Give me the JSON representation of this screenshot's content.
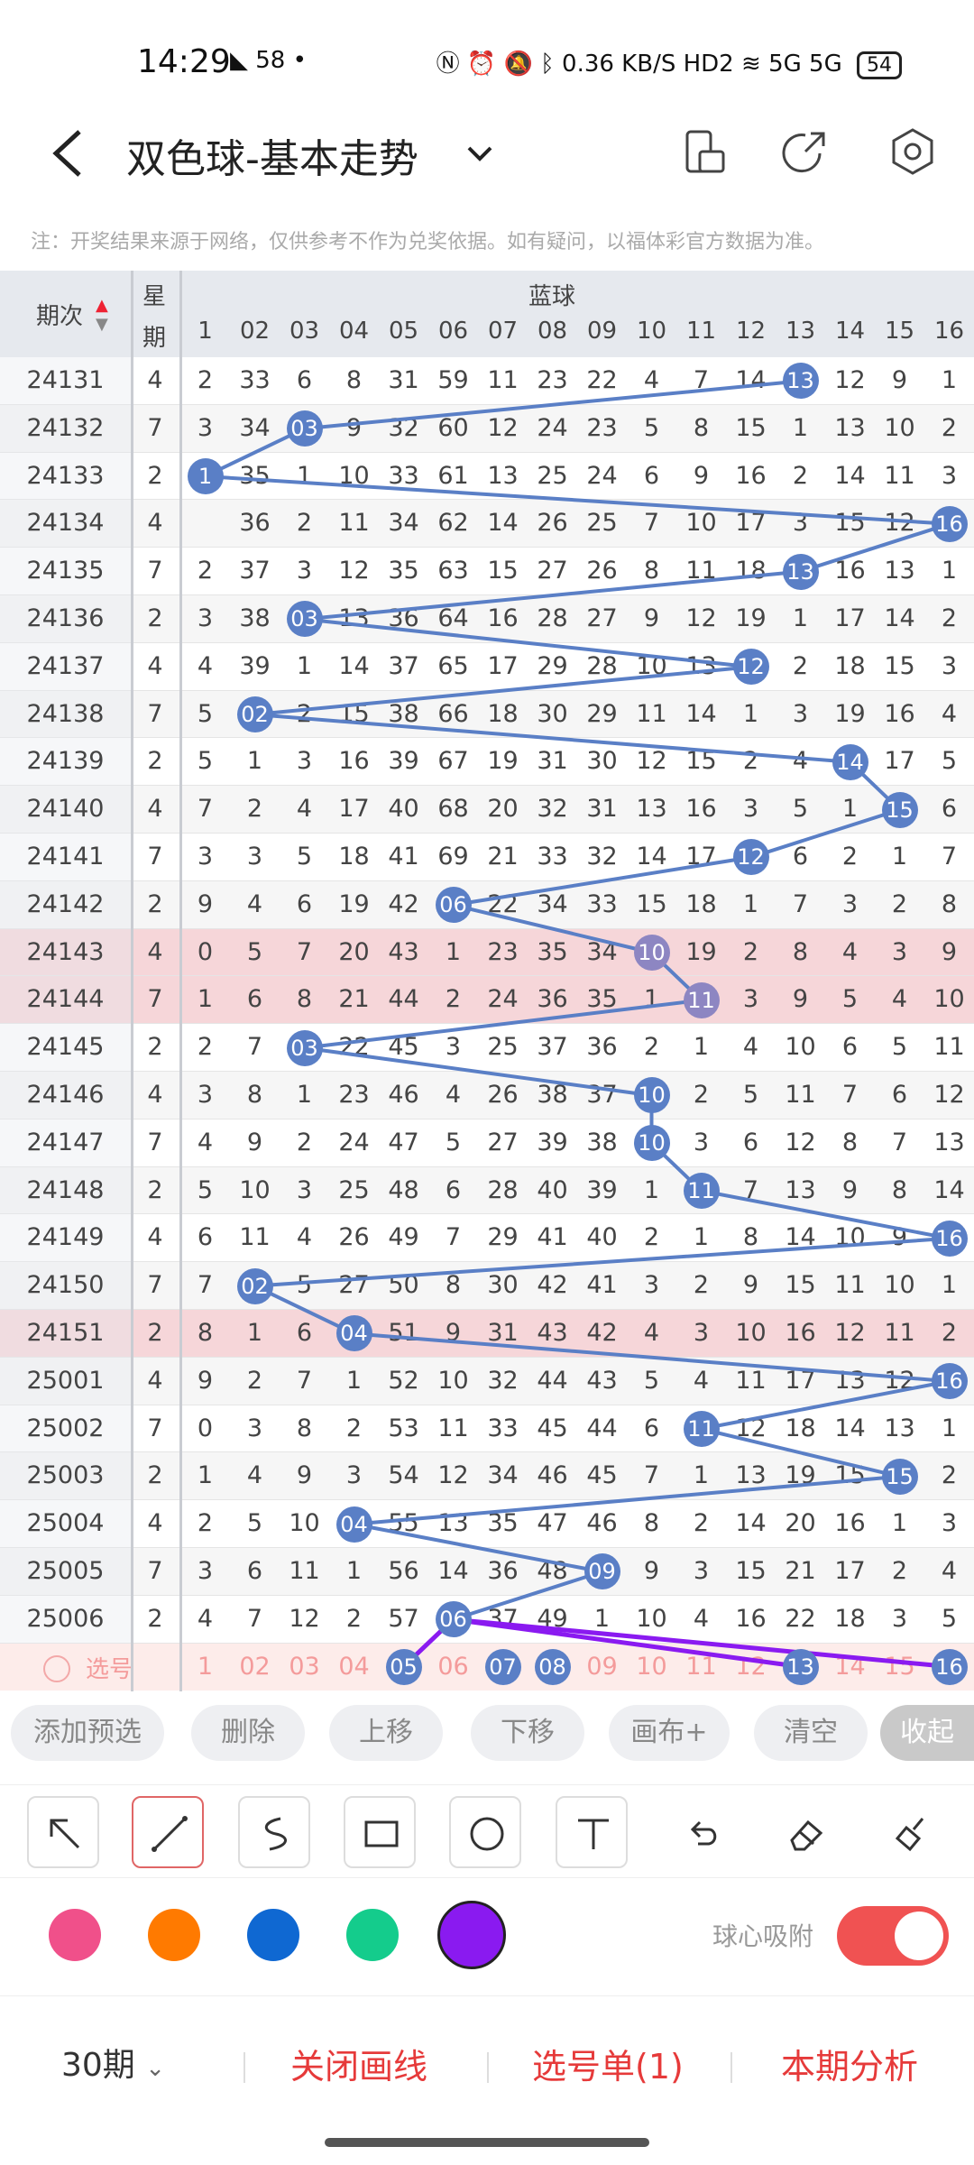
{
  "status": {
    "time": "14:29",
    "net_speed": "0.36 KB/S",
    "hd": "HD2",
    "signal_a": "5G",
    "signal_b": "5G",
    "battery": "54"
  },
  "header": {
    "title": "双色球-基本走势"
  },
  "notice": "注：开奖结果来源于网络，仅供参考不作为兑奖依据。如有疑问，以福体彩官方数据为准。",
  "table": {
    "col_issue": "期次",
    "col_week_1": "星",
    "col_week_2": "期",
    "blue_label": "蓝球",
    "headers": [
      "1",
      "02",
      "03",
      "04",
      "05",
      "06",
      "07",
      "08",
      "09",
      "10",
      "11",
      "12",
      "13",
      "14",
      "15",
      "16"
    ],
    "rows": [
      {
        "issue": "24131",
        "week": "4",
        "cells": [
          "2",
          "33",
          "6",
          "8",
          "31",
          "59",
          "11",
          "23",
          "22",
          "4",
          "7",
          "14",
          "13",
          "12",
          "9",
          "1"
        ],
        "ball": 13
      },
      {
        "issue": "24132",
        "week": "7",
        "cells": [
          "3",
          "34",
          "03",
          "9",
          "32",
          "60",
          "12",
          "24",
          "23",
          "5",
          "8",
          "15",
          "1",
          "13",
          "10",
          "2"
        ],
        "ball": 3
      },
      {
        "issue": "24133",
        "week": "2",
        "cells": [
          "1",
          "35",
          "1",
          "10",
          "33",
          "61",
          "13",
          "25",
          "24",
          "6",
          "9",
          "16",
          "2",
          "14",
          "11",
          "3"
        ],
        "ball": 1
      },
      {
        "issue": "24134",
        "week": "4",
        "cells": [
          "",
          "36",
          "2",
          "11",
          "34",
          "62",
          "14",
          "26",
          "25",
          "7",
          "10",
          "17",
          "3",
          "15",
          "12",
          "16"
        ],
        "ball": 16
      },
      {
        "issue": "24135",
        "week": "7",
        "cells": [
          "2",
          "37",
          "3",
          "12",
          "35",
          "63",
          "15",
          "27",
          "26",
          "8",
          "11",
          "18",
          "13",
          "16",
          "13",
          "1"
        ],
        "ball": 13
      },
      {
        "issue": "24136",
        "week": "2",
        "cells": [
          "3",
          "38",
          "03",
          "13",
          "36",
          "64",
          "16",
          "28",
          "27",
          "9",
          "12",
          "19",
          "1",
          "17",
          "14",
          "2"
        ],
        "ball": 3
      },
      {
        "issue": "24137",
        "week": "4",
        "cells": [
          "4",
          "39",
          "1",
          "14",
          "37",
          "65",
          "17",
          "29",
          "28",
          "10",
          "13",
          "12",
          "2",
          "18",
          "15",
          "3"
        ],
        "ball": 12
      },
      {
        "issue": "24138",
        "week": "7",
        "cells": [
          "5",
          "02",
          "2",
          "15",
          "38",
          "66",
          "18",
          "30",
          "29",
          "11",
          "14",
          "1",
          "3",
          "19",
          "16",
          "4"
        ],
        "ball": 2
      },
      {
        "issue": "24139",
        "week": "2",
        "cells": [
          "5",
          "1",
          "3",
          "16",
          "39",
          "67",
          "19",
          "31",
          "30",
          "12",
          "15",
          "2",
          "4",
          "14",
          "17",
          "5"
        ],
        "ball": 14
      },
      {
        "issue": "24140",
        "week": "4",
        "cells": [
          "7",
          "2",
          "4",
          "17",
          "40",
          "68",
          "20",
          "32",
          "31",
          "13",
          "16",
          "3",
          "5",
          "1",
          "15",
          "6"
        ],
        "ball": 15
      },
      {
        "issue": "24141",
        "week": "7",
        "cells": [
          "3",
          "3",
          "5",
          "18",
          "41",
          "69",
          "21",
          "33",
          "32",
          "14",
          "17",
          "12",
          "6",
          "2",
          "1",
          "7"
        ],
        "ball": 12
      },
      {
        "issue": "24142",
        "week": "2",
        "cells": [
          "9",
          "4",
          "6",
          "19",
          "42",
          "06",
          "22",
          "34",
          "33",
          "15",
          "18",
          "1",
          "7",
          "3",
          "2",
          "8"
        ],
        "ball": 6
      },
      {
        "issue": "24143",
        "week": "4",
        "cells": [
          "0",
          "5",
          "7",
          "20",
          "43",
          "1",
          "23",
          "35",
          "34",
          "10",
          "19",
          "2",
          "8",
          "4",
          "3",
          "9"
        ],
        "ball": 10
      },
      {
        "issue": "24144",
        "week": "7",
        "cells": [
          "1",
          "6",
          "8",
          "21",
          "44",
          "2",
          "24",
          "36",
          "35",
          "1",
          "11",
          "3",
          "9",
          "5",
          "4",
          "10"
        ],
        "ball": 11
      },
      {
        "issue": "24145",
        "week": "2",
        "cells": [
          "2",
          "7",
          "03",
          "22",
          "45",
          "3",
          "25",
          "37",
          "36",
          "2",
          "1",
          "4",
          "10",
          "6",
          "5",
          "11"
        ],
        "ball": 3
      },
      {
        "issue": "24146",
        "week": "4",
        "cells": [
          "3",
          "8",
          "1",
          "23",
          "46",
          "4",
          "26",
          "38",
          "37",
          "10",
          "2",
          "5",
          "11",
          "7",
          "6",
          "12"
        ],
        "ball": 10
      },
      {
        "issue": "24147",
        "week": "7",
        "cells": [
          "4",
          "9",
          "2",
          "24",
          "47",
          "5",
          "27",
          "39",
          "38",
          "10",
          "3",
          "6",
          "12",
          "8",
          "7",
          "13"
        ],
        "ball": 10
      },
      {
        "issue": "24148",
        "week": "2",
        "cells": [
          "5",
          "10",
          "3",
          "25",
          "48",
          "6",
          "28",
          "40",
          "39",
          "1",
          "11",
          "7",
          "13",
          "9",
          "8",
          "14"
        ],
        "ball": 11
      },
      {
        "issue": "24149",
        "week": "4",
        "cells": [
          "6",
          "11",
          "4",
          "26",
          "49",
          "7",
          "29",
          "41",
          "40",
          "2",
          "1",
          "8",
          "14",
          "10",
          "9",
          "16"
        ],
        "ball": 16
      },
      {
        "issue": "24150",
        "week": "7",
        "cells": [
          "7",
          "02",
          "5",
          "27",
          "50",
          "8",
          "30",
          "42",
          "41",
          "3",
          "2",
          "9",
          "15",
          "11",
          "10",
          "1"
        ],
        "ball": 2
      },
      {
        "issue": "24151",
        "week": "2",
        "cells": [
          "8",
          "1",
          "6",
          "04",
          "51",
          "9",
          "31",
          "43",
          "42",
          "4",
          "3",
          "10",
          "16",
          "12",
          "11",
          "2"
        ],
        "ball": 4
      },
      {
        "issue": "25001",
        "week": "4",
        "cells": [
          "9",
          "2",
          "7",
          "1",
          "52",
          "10",
          "32",
          "44",
          "43",
          "5",
          "4",
          "11",
          "17",
          "13",
          "12",
          "16"
        ],
        "ball": 16
      },
      {
        "issue": "25002",
        "week": "7",
        "cells": [
          "0",
          "3",
          "8",
          "2",
          "53",
          "11",
          "33",
          "45",
          "44",
          "6",
          "11",
          "12",
          "18",
          "14",
          "13",
          "1"
        ],
        "ball": 11
      },
      {
        "issue": "25003",
        "week": "2",
        "cells": [
          "1",
          "4",
          "9",
          "3",
          "54",
          "12",
          "34",
          "46",
          "45",
          "7",
          "1",
          "13",
          "19",
          "15",
          "15",
          "2"
        ],
        "ball": 15
      },
      {
        "issue": "25004",
        "week": "4",
        "cells": [
          "2",
          "5",
          "10",
          "04",
          "55",
          "13",
          "35",
          "47",
          "46",
          "8",
          "2",
          "14",
          "20",
          "16",
          "1",
          "3"
        ],
        "ball": 4
      },
      {
        "issue": "25005",
        "week": "7",
        "cells": [
          "3",
          "6",
          "11",
          "1",
          "56",
          "14",
          "36",
          "48",
          "09",
          "9",
          "3",
          "15",
          "21",
          "17",
          "2",
          "4"
        ],
        "ball": 9
      },
      {
        "issue": "25006",
        "week": "2",
        "cells": [
          "4",
          "7",
          "12",
          "2",
          "57",
          "06",
          "37",
          "49",
          "1",
          "10",
          "4",
          "16",
          "22",
          "18",
          "3",
          "5"
        ],
        "ball": 6
      }
    ],
    "select_label": "选号",
    "select_cells": [
      "1",
      "02",
      "03",
      "04",
      "05",
      "06",
      "07",
      "08",
      "09",
      "10",
      "11",
      "12",
      "13",
      "14",
      "15",
      "16"
    ],
    "select_balls": [
      5,
      7,
      8,
      13,
      16
    ]
  },
  "actions": [
    "添加预选",
    "删除",
    "上移",
    "下移",
    "画布+",
    "清空",
    "收起"
  ],
  "colors": {
    "accent": "#e63a3a",
    "ball": "#5a7fc6",
    "swatches": [
      "#f0508a",
      "#ff7a00",
      "#0f68d2",
      "#14cc8c",
      "#8a1af0"
    ]
  },
  "snap_label": "球心吸附",
  "bottom": {
    "periods": "30期",
    "close_draw": "关闭画线",
    "pick_list": "选号单(1)",
    "analysis": "本期分析"
  }
}
